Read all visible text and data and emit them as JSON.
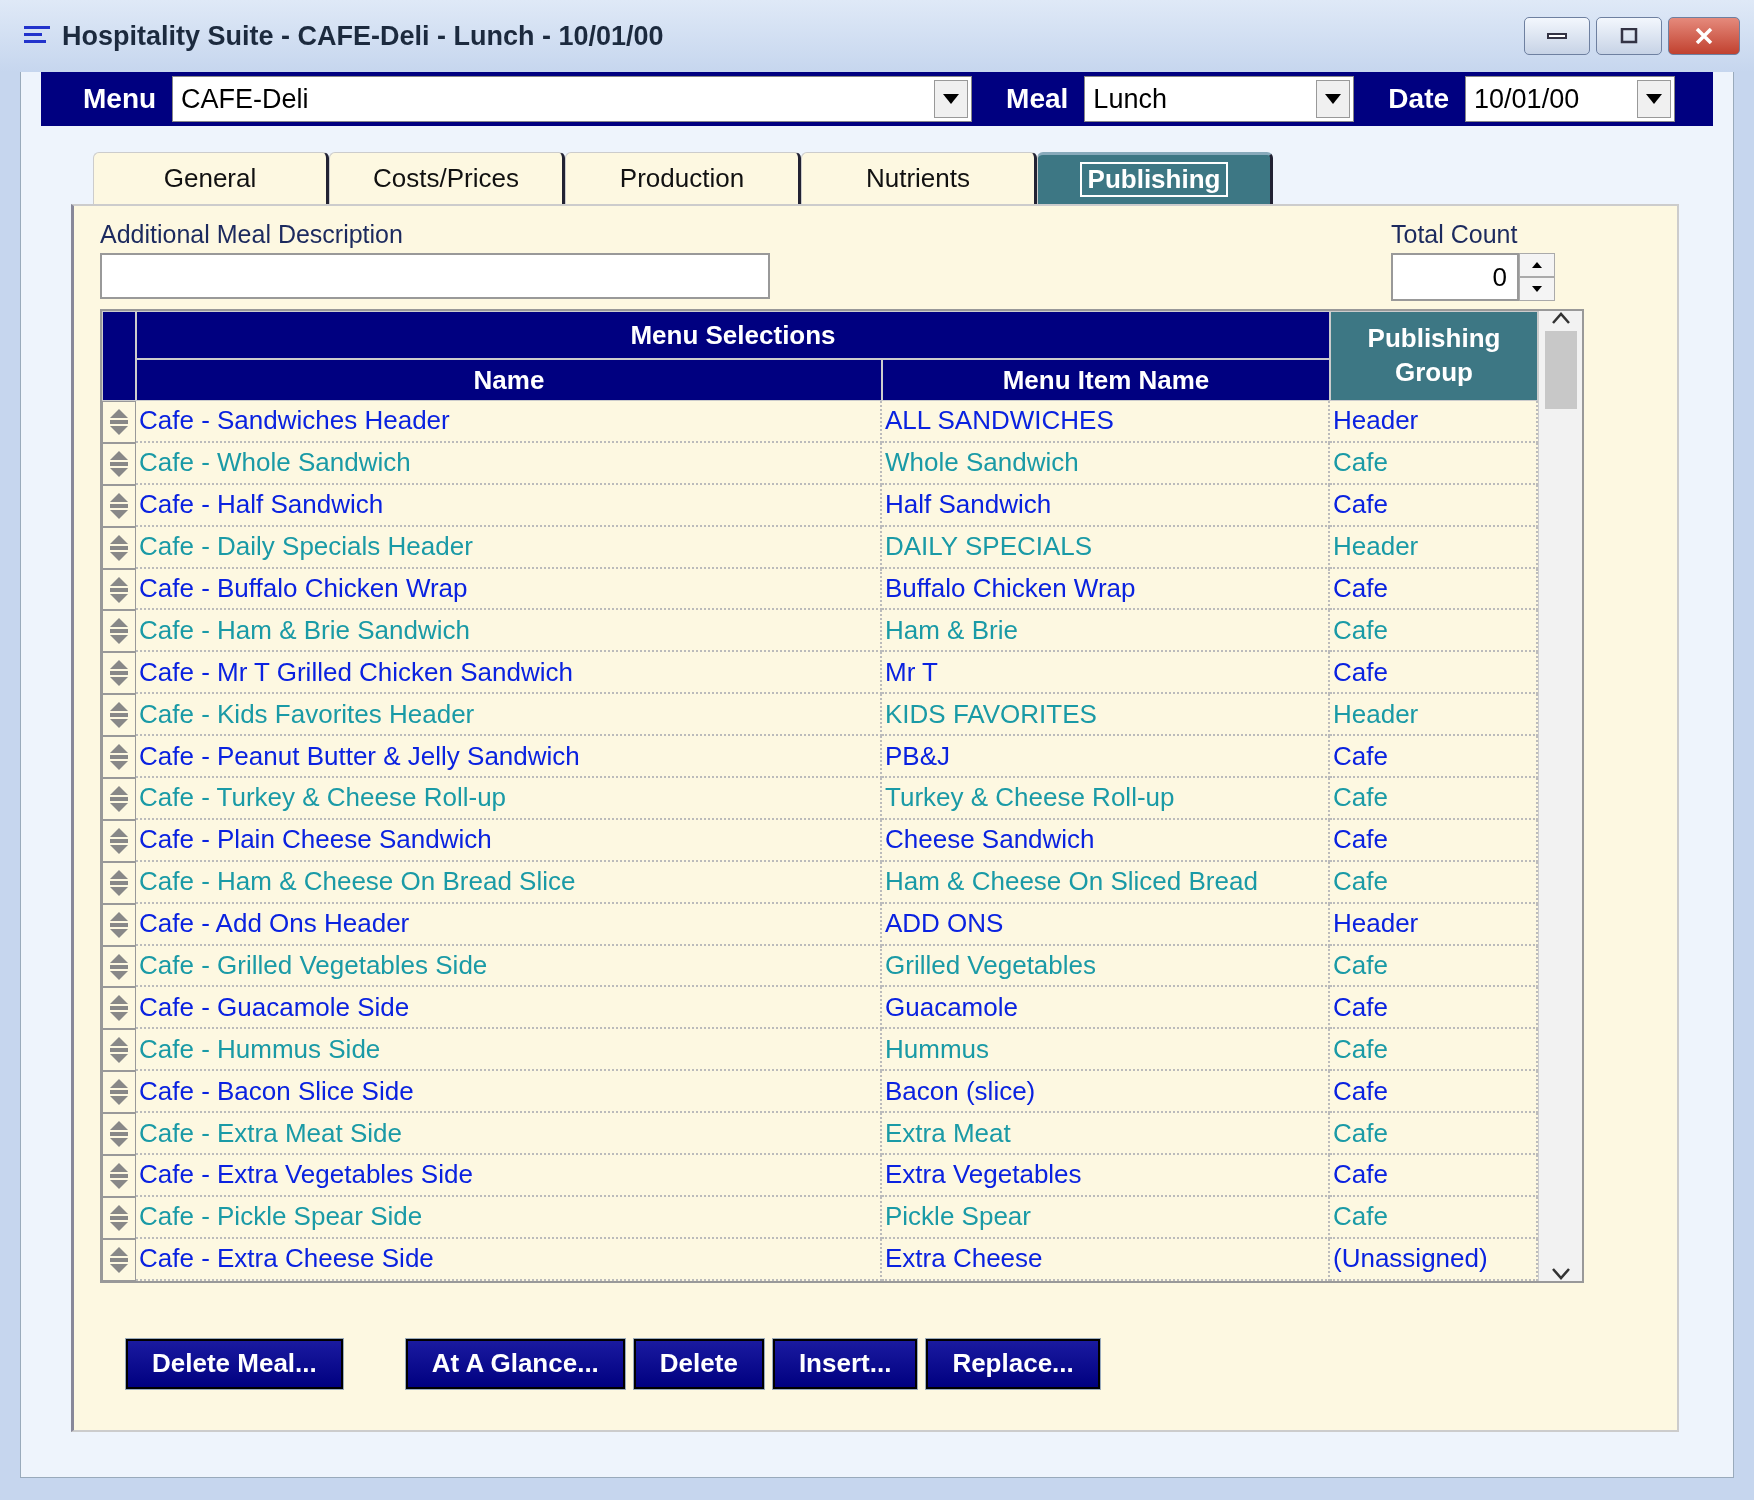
{
  "window": {
    "title": "Hospitality Suite - CAFE-Deli - Lunch - 10/01/00"
  },
  "selectors": [
    {
      "label": "Menu",
      "value": "CAFE-Deli",
      "kind": "wide"
    },
    {
      "label": "Meal",
      "value": "Lunch",
      "kind": "medium"
    },
    {
      "label": "Date",
      "value": "10/01/00",
      "kind": "narrow"
    }
  ],
  "tabs": [
    {
      "label": "General",
      "selected": false
    },
    {
      "label": "Costs/Prices",
      "selected": false
    },
    {
      "label": "Production",
      "selected": false
    },
    {
      "label": "Nutrients",
      "selected": false
    },
    {
      "label": "Publishing",
      "selected": true
    }
  ],
  "description": {
    "label": "Additional Meal Description"
  },
  "total_count": {
    "label": "Total Count",
    "value": "0"
  },
  "table": {
    "group_header": "Menu Selections",
    "columns": [
      "Name",
      "Menu Item Name",
      "Publishing Group"
    ],
    "rows": [
      {
        "name": "Cafe - Sandwiches Header",
        "item": "ALL SANDWICHES",
        "group": "Header",
        "color": "#0a22e0"
      },
      {
        "name": "Cafe - Whole Sandwich",
        "item": "Whole Sandwich",
        "group": "Cafe",
        "color": "#1a9aa6"
      },
      {
        "name": "Cafe - Half Sandwich",
        "item": "Half Sandwich",
        "group": "Cafe",
        "color": "#0a22e0"
      },
      {
        "name": "Cafe - Daily Specials Header",
        "item": "DAILY SPECIALS",
        "group": "Header",
        "color": "#1a9aa6"
      },
      {
        "name": "Cafe - Buffalo Chicken Wrap",
        "item": "Buffalo Chicken Wrap",
        "group": "Cafe",
        "color": "#0a22e0"
      },
      {
        "name": "Cafe - Ham & Brie Sandwich",
        "item": "Ham & Brie",
        "group": "Cafe",
        "color": "#1a9aa6"
      },
      {
        "name": "Cafe - Mr T Grilled Chicken Sandwich",
        "item": "Mr T",
        "group": "Cafe",
        "color": "#0a22e0"
      },
      {
        "name": "Cafe - Kids Favorites Header",
        "item": "KIDS FAVORITES",
        "group": "Header",
        "color": "#1a9aa6"
      },
      {
        "name": "Cafe - Peanut Butter & Jelly Sandwich",
        "item": "PB&J",
        "group": "Cafe",
        "color": "#0a22e0"
      },
      {
        "name": "Cafe - Turkey & Cheese Roll-up",
        "item": "Turkey & Cheese Roll-up",
        "group": "Cafe",
        "color": "#1a9aa6"
      },
      {
        "name": "Cafe - Plain Cheese Sandwich",
        "item": "Cheese Sandwich",
        "group": "Cafe",
        "color": "#0a22e0"
      },
      {
        "name": "Cafe - Ham & Cheese On Bread Slice",
        "item": "Ham & Cheese On Sliced Bread",
        "group": "Cafe",
        "color": "#1a9aa6"
      },
      {
        "name": "Cafe - Add Ons Header",
        "item": "ADD ONS",
        "group": "Header",
        "color": "#0a22e0"
      },
      {
        "name": "Cafe - Grilled Vegetables Side",
        "item": "Grilled Vegetables",
        "group": "Cafe",
        "color": "#1a9aa6"
      },
      {
        "name": "Cafe - Guacamole Side",
        "item": "Guacamole",
        "group": "Cafe",
        "color": "#0a22e0"
      },
      {
        "name": "Cafe - Hummus Side",
        "item": "Hummus",
        "group": "Cafe",
        "color": "#1a9aa6"
      },
      {
        "name": "Cafe - Bacon Slice Side",
        "item": "Bacon (slice)",
        "group": "Cafe",
        "color": "#0a22e0"
      },
      {
        "name": "Cafe - Extra Meat Side",
        "item": "Extra Meat",
        "group": "Cafe",
        "color": "#1a9aa6"
      },
      {
        "name": "Cafe - Extra Vegetables Side",
        "item": "Extra Vegetables",
        "group": "Cafe",
        "color": "#0a22e0"
      },
      {
        "name": "Cafe - Pickle Spear Side",
        "item": "Pickle Spear",
        "group": "Cafe",
        "color": "#1a9aa6"
      },
      {
        "name": "Cafe - Extra Cheese Side",
        "item": "Extra Cheese",
        "group": "(Unassigned)",
        "color": "#0a22e0"
      }
    ]
  },
  "buttons": [
    {
      "label": "Delete Meal...",
      "kind": "gap"
    },
    {
      "label": "At A Glance...",
      "kind": "plain"
    },
    {
      "label": "Delete",
      "kind": "plain"
    },
    {
      "label": "Insert...",
      "kind": "plain"
    },
    {
      "label": "Replace...",
      "kind": "plain"
    }
  ]
}
